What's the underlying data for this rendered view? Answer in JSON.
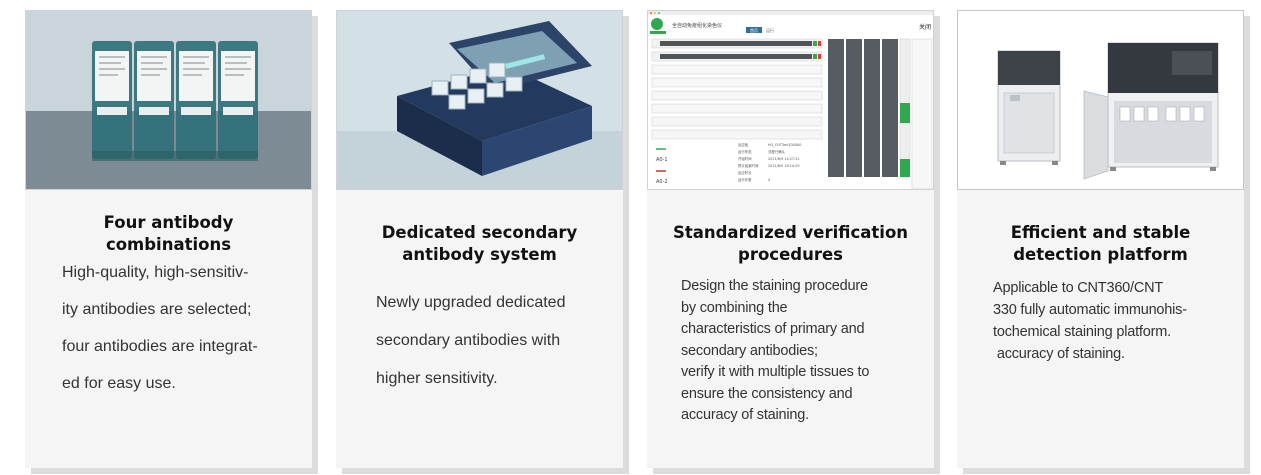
{
  "cards": [
    {
      "image_name": "antibody-vials-photo",
      "title": "Four antibody combinations",
      "body_lines": [
        "High-quality, high-sensitiv-",
        "ity antibodies are selected;",
        "four antibodies are integrat-",
        "ed for easy use."
      ]
    },
    {
      "image_name": "secondary-antibody-box-photo",
      "title_lines": [
        "Dedicated secondary",
        "antibody system"
      ],
      "body_lines": [
        "Newly upgraded dedicated",
        "secondary antibodies with",
        "higher sensitivity."
      ]
    },
    {
      "image_name": "staining-software-screenshot",
      "title_lines": [
        "Standardized verification",
        "procedures"
      ],
      "body_lines": [
        "Design the staining procedure",
        "by combining the",
        "characteristics of primary and",
        "secondary antibodies;",
        "verify it with multiple tissues to",
        "ensure the consistency and",
        "accuracy of staining."
      ],
      "software": {
        "window_title": "全自动免疫组化染色仪",
        "tabs": [
          "首页",
          "运行"
        ],
        "close_label": "关闭",
        "side_labels": [
          "A0-1",
          "A0-2"
        ],
        "info_labels": [
          "反应板",
          "运行状态",
          "开始时间",
          "预计结束时间",
          "反应时长",
          "运行步数"
        ],
        "info_values": [
          "HQ_CHT3en3000A0",
          "流程已确认",
          "2021/6/9 14:27:21",
          "2021/6/9 16:14:29",
          "",
          "4"
        ]
      }
    },
    {
      "image_name": "cnt-staining-instruments-photo",
      "title_lines": [
        "Efficient and stable",
        "detection platform"
      ],
      "body_lines": [
        "Applicable to CNT360/CNT",
        "330 fully automatic immunohis-",
        "tochemical staining platform.",
        " accuracy of staining."
      ]
    }
  ],
  "colors": {
    "card_bg": "#f5f5f5",
    "card_shadow": "#dcdcdc",
    "software_accent": "#2fa84f",
    "software_dark_bar": "#555b60"
  }
}
